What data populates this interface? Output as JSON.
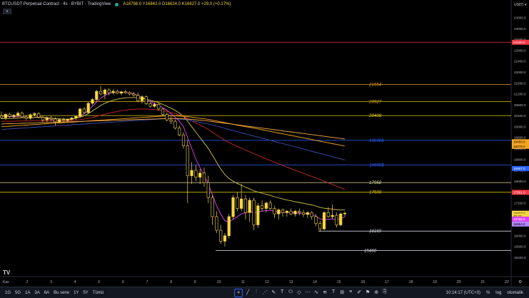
{
  "header": {
    "symbol": "BTCUSDT Perpetual Contract · 4s · BYBIT · TradingView",
    "ohlc": "A16798.0  Y16842.0  D16624.0  K16827.0  +29.0 (+0.17%)",
    "collapse": "∧"
  },
  "price_axis": {
    "currency": "USDT ▾",
    "ticks": [
      "24000.0",
      "23600.0",
      "23200.0",
      "22800.0",
      "22400.0",
      "22000.0",
      "21600.0",
      "21200.0",
      "20800.0",
      "20400.0",
      "20000.0",
      "19600.0",
      "19200.0",
      "18800.0",
      "18400.0",
      "18000.0",
      "17600.0",
      "17200.0",
      "16800.0",
      "16400.0",
      "16000.0",
      "15600.0",
      "15200.0"
    ],
    "min": 14500,
    "max": 24650,
    "badges": [
      {
        "price": 23100,
        "label": "23100.0",
        "bg": "#f23645",
        "fg": "#ffffff"
      },
      {
        "price": 19450,
        "label": "19450.0",
        "bg": "#f5a623",
        "fg": "#000000"
      },
      {
        "price": 19280,
        "label": "19278.0",
        "bg": "#f5a623",
        "fg": "#000000"
      },
      {
        "price": 18467,
        "label": "18467.0",
        "bg": "#2962ff",
        "fg": "#ffffff"
      },
      {
        "price": 17591,
        "label": "17591.0",
        "bg": "#f23645",
        "fg": "#ffffff"
      },
      {
        "price": 16827,
        "label": "16827.0",
        "bg": "#f5d742",
        "fg": "#000000"
      },
      {
        "price": 16720,
        "label": "45:42",
        "bg": "#f5d742",
        "fg": "#000000"
      },
      {
        "price": 16610,
        "label": "16795.5",
        "bg": "#e040fb",
        "fg": "#ffffff"
      },
      {
        "price": 16430,
        "label": "16654.0",
        "bg": "#b388ff",
        "fg": "#000000"
      }
    ]
  },
  "time_axis": {
    "labels": [
      "Kas",
      "2",
      "3",
      "4",
      "5",
      "6",
      "7",
      "8",
      "9",
      "10",
      "11",
      "12",
      "13",
      "14",
      "15",
      "16",
      "17",
      "18",
      "19",
      "20",
      "21",
      "22"
    ],
    "gear": "⚙"
  },
  "levels": [
    {
      "price": 23100,
      "label": "",
      "color": "#f23645",
      "x0": 0
    },
    {
      "price": 21554,
      "label": "21554",
      "color": "#e5a01d",
      "x0": 0
    },
    {
      "price": 20927,
      "label": "20927",
      "color": "#d4b106",
      "x0": 0
    },
    {
      "price": 20408,
      "label": "20408",
      "color": "#e8d200",
      "x0": 0
    },
    {
      "price": 19500,
      "label": "19500$",
      "color": "#2962ff",
      "x0": 0
    },
    {
      "price": 18600,
      "label": "18600$",
      "color": "#2962ff",
      "x0": 0
    },
    {
      "price": 17950,
      "label": "17950",
      "color": "#e8e0a0",
      "x0": 0
    },
    {
      "price": 17600,
      "label": "17600",
      "color": "#e8d200",
      "x0": 0
    },
    {
      "price": 16169,
      "label": "16169",
      "color": "#d1d4dc",
      "x0": 446
    },
    {
      "price": 15460,
      "label": "15460",
      "color": "#d1d4dc",
      "x0": 302
    }
  ],
  "chart_data": {
    "type": "candlestick",
    "y_range": [
      14500,
      24650
    ],
    "candle_color": "#f5d742",
    "candles": [
      [
        20400,
        20560,
        20280,
        20330
      ],
      [
        20330,
        20480,
        20250,
        20460
      ],
      [
        20460,
        20520,
        20330,
        20380
      ],
      [
        20380,
        20470,
        20300,
        20420
      ],
      [
        20420,
        20560,
        20360,
        20500
      ],
      [
        20500,
        20560,
        20320,
        20360
      ],
      [
        20360,
        20420,
        20240,
        20310
      ],
      [
        20310,
        20480,
        20250,
        20440
      ],
      [
        20440,
        20530,
        20380,
        20480
      ],
      [
        20480,
        20540,
        20300,
        20350
      ],
      [
        20350,
        20400,
        20180,
        20250
      ],
      [
        20250,
        20380,
        20150,
        20320
      ],
      [
        20320,
        20400,
        20210,
        20280
      ],
      [
        20280,
        20350,
        20050,
        20180
      ],
      [
        20180,
        20300,
        20120,
        20260
      ],
      [
        20260,
        20330,
        20180,
        20230
      ],
      [
        20230,
        20300,
        20150,
        20270
      ],
      [
        20270,
        20360,
        20220,
        20320
      ],
      [
        20320,
        20420,
        20260,
        20380
      ],
      [
        20380,
        20700,
        20330,
        20650
      ],
      [
        20650,
        20720,
        20450,
        20520
      ],
      [
        20520,
        20900,
        20480,
        20860
      ],
      [
        20860,
        21050,
        20800,
        21000
      ],
      [
        21000,
        21350,
        20940,
        21300
      ],
      [
        21300,
        21500,
        21150,
        21200
      ],
      [
        21200,
        21400,
        21000,
        21350
      ],
      [
        21350,
        21420,
        21150,
        21250
      ],
      [
        21250,
        21380,
        21180,
        21300
      ],
      [
        21300,
        21360,
        21200,
        21230
      ],
      [
        21230,
        21320,
        21150,
        21280
      ],
      [
        21280,
        21350,
        21200,
        21250
      ],
      [
        21250,
        21300,
        21150,
        21200
      ],
      [
        21200,
        21280,
        21100,
        21150
      ],
      [
        21150,
        21250,
        20900,
        20950
      ],
      [
        20950,
        21150,
        20850,
        21100
      ],
      [
        21100,
        21150,
        20800,
        20850
      ],
      [
        20850,
        20900,
        20700,
        20750
      ],
      [
        20750,
        20900,
        20700,
        20820
      ],
      [
        20820,
        20880,
        20600,
        20650
      ],
      [
        20650,
        20700,
        20400,
        20450
      ],
      [
        20450,
        20520,
        20200,
        20250
      ],
      [
        20250,
        20380,
        20100,
        20200
      ],
      [
        20200,
        20260,
        19900,
        19950
      ],
      [
        19950,
        20050,
        19650,
        19700
      ],
      [
        19700,
        19800,
        19200,
        19300
      ],
      [
        19300,
        19500,
        17200,
        18200
      ],
      [
        18200,
        18700,
        17900,
        18400
      ],
      [
        18400,
        18600,
        18000,
        18150
      ],
      [
        18150,
        18450,
        17900,
        18300
      ],
      [
        18300,
        18500,
        17800,
        17950
      ],
      [
        17950,
        18200,
        17200,
        17400
      ],
      [
        17400,
        17500,
        16400,
        16700
      ],
      [
        16700,
        16900,
        16100,
        16200
      ],
      [
        16200,
        16400,
        15700,
        15800
      ],
      [
        15800,
        16100,
        15600,
        16000
      ],
      [
        16000,
        16800,
        15900,
        16700
      ],
      [
        16700,
        17500,
        16600,
        17400
      ],
      [
        17400,
        17600,
        16900,
        17000
      ],
      [
        17000,
        17900,
        16900,
        17350
      ],
      [
        17350,
        17500,
        16600,
        16850
      ],
      [
        16850,
        17400,
        16500,
        17300
      ],
      [
        17300,
        17400,
        16200,
        16400
      ],
      [
        16400,
        17200,
        16300,
        17100
      ],
      [
        17100,
        17300,
        16900,
        17000
      ],
      [
        17000,
        17250,
        16850,
        17200
      ],
      [
        17200,
        17300,
        16950,
        17000
      ],
      [
        17000,
        17100,
        16650,
        16800
      ],
      [
        16800,
        17000,
        16600,
        16950
      ],
      [
        16950,
        17000,
        16700,
        16850
      ],
      [
        16850,
        16950,
        16700,
        16900
      ],
      [
        16900,
        17000,
        16750,
        16800
      ],
      [
        16800,
        16950,
        16700,
        16900
      ],
      [
        16900,
        17000,
        16750,
        16850
      ],
      [
        16850,
        16950,
        16680,
        16780
      ],
      [
        16780,
        16900,
        16650,
        16850
      ],
      [
        16850,
        16900,
        16600,
        16700
      ],
      [
        16700,
        16800,
        16350,
        16450
      ],
      [
        16450,
        16550,
        16150,
        16250
      ],
      [
        16250,
        16900,
        16200,
        16850
      ],
      [
        16850,
        17050,
        16650,
        16700
      ],
      [
        16700,
        17150,
        16600,
        16750
      ],
      [
        16750,
        16850,
        16300,
        16400
      ],
      [
        16400,
        16850,
        16350,
        16800
      ],
      [
        16800,
        16890,
        16700,
        16827
      ]
    ],
    "ma_lines": [
      {
        "color": "#e040fb",
        "values": [
          20400,
          20380,
          20370,
          20360,
          20380,
          20390,
          20350,
          20320,
          20340,
          20380,
          20350,
          20300,
          20270,
          20230,
          20220,
          20230,
          20240,
          20270,
          20320,
          20400,
          20480,
          20600,
          20750,
          20900,
          21050,
          21150,
          21220,
          21260,
          21270,
          21270,
          21260,
          21240,
          21210,
          21150,
          21080,
          21000,
          20920,
          20850,
          20780,
          20700,
          20600,
          20480,
          20350,
          20200,
          20000,
          19600,
          19200,
          18800,
          18500,
          18200,
          17900,
          17500,
          17100,
          16800,
          16550,
          16500,
          16600,
          16700,
          16800,
          16850,
          16900,
          16850,
          16870,
          16900,
          16920,
          16930,
          16900,
          16880,
          16860,
          16850,
          16840,
          16830,
          16830,
          16820,
          16810,
          16790,
          16720,
          16620,
          16600,
          16600,
          16620,
          16580,
          16620,
          16700
        ]
      },
      {
        "color": "#d4c24a",
        "values": [
          20300,
          20300,
          20300,
          20310,
          20320,
          20330,
          20330,
          20330,
          20340,
          20350,
          20340,
          20330,
          20320,
          20300,
          20290,
          20280,
          20280,
          20290,
          20310,
          20350,
          20400,
          20480,
          20580,
          20680,
          20780,
          20860,
          20920,
          20970,
          21010,
          21040,
          21060,
          21070,
          21070,
          21060,
          21040,
          21010,
          20970,
          20930,
          20880,
          20820,
          20750,
          20680,
          20600,
          20500,
          20380,
          20200,
          20000,
          19800,
          19600,
          19400,
          19200,
          18950,
          18700,
          18450,
          18250,
          18100,
          18000,
          17920,
          17850,
          17780,
          17720,
          17650,
          17600,
          17560,
          17520,
          17480,
          17430,
          17390,
          17350,
          17310,
          17280,
          17250,
          17220,
          17190,
          17160,
          17130,
          17090,
          17040,
          17010,
          16990,
          16980,
          16960,
          16950,
          16950
        ]
      },
      {
        "color": "#c62828",
        "values": [
          20200,
          20200,
          20200,
          20200,
          20210,
          20210,
          20210,
          20210,
          20220,
          20220,
          20220,
          20220,
          20220,
          20220,
          20220,
          20220,
          20220,
          20230,
          20240,
          20260,
          20280,
          20310,
          20340,
          20380,
          20420,
          20460,
          20500,
          20530,
          20560,
          20590,
          20610,
          20630,
          20640,
          20650,
          20650,
          20650,
          20640,
          20630,
          20610,
          20590,
          20560,
          20520,
          20480,
          20440,
          20380,
          20300,
          20220,
          20140,
          20060,
          19980,
          19900,
          19800,
          19700,
          19600,
          19500,
          19420,
          19350,
          19280,
          19210,
          19140,
          19080,
          19010,
          18950,
          18880,
          18820,
          18760,
          18700,
          18640,
          18580,
          18520,
          18460,
          18400,
          18350,
          18290,
          18230,
          18180,
          18120,
          18060,
          18000,
          17940,
          17880,
          17820,
          17760,
          17700
        ]
      },
      {
        "color": "#3f51b5",
        "values": [
          19900,
          19910,
          19920,
          19930,
          19940,
          19950,
          19960,
          19970,
          19980,
          19990,
          20000,
          20010,
          20020,
          20030,
          20040,
          20050,
          20060,
          20070,
          20080,
          20090,
          20100,
          20110,
          20120,
          20130,
          20140,
          20150,
          20160,
          20170,
          20180,
          20190,
          20200,
          20210,
          20220,
          20230,
          20240,
          20250,
          20260,
          20270,
          20280,
          20290,
          20300,
          20300,
          20290,
          20280,
          20270,
          20250,
          20220,
          20190,
          20160,
          20130,
          20100,
          20060,
          20020,
          19980,
          19940,
          19900,
          19860,
          19820,
          19780,
          19740,
          19700,
          19660,
          19620,
          19580,
          19540,
          19500,
          19460,
          19420,
          19380,
          19340,
          19300,
          19260,
          19220,
          19180,
          19140,
          19100,
          19060,
          19020,
          18980,
          18940,
          18900,
          18860,
          18820,
          18780
        ]
      },
      {
        "color": "#f5a623",
        "values": [
          20000,
          20010,
          20020,
          20030,
          20040,
          20050,
          20060,
          20070,
          20080,
          20090,
          20100,
          20110,
          20120,
          20130,
          20140,
          20150,
          20160,
          20170,
          20180,
          20190,
          20200,
          20210,
          20220,
          20230,
          20240,
          20250,
          20260,
          20270,
          20280,
          20290,
          20300,
          20310,
          20320,
          20330,
          20340,
          20350,
          20360,
          20370,
          20380,
          20390,
          20400,
          20400,
          20400,
          20390,
          20380,
          20370,
          20350,
          20330,
          20310,
          20290,
          20270,
          20240,
          20210,
          20180,
          20150,
          20120,
          20090,
          20060,
          20030,
          20000,
          19980,
          19950,
          19920,
          19890,
          19860,
          19830,
          19800,
          19770,
          19740,
          19710,
          19680,
          19650,
          19620,
          19590,
          19560,
          19530,
          19500,
          19470,
          19440,
          19410,
          19380,
          19350,
          19320,
          19290
        ]
      },
      {
        "color": "#f8a94b",
        "values": [
          20100,
          20105,
          20110,
          20115,
          20120,
          20125,
          20130,
          20135,
          20140,
          20145,
          20150,
          20155,
          20160,
          20165,
          20170,
          20175,
          20180,
          20185,
          20190,
          20195,
          20200,
          20205,
          20210,
          20215,
          20220,
          20225,
          20230,
          20235,
          20240,
          20245,
          20250,
          20255,
          20260,
          20265,
          20270,
          20275,
          20280,
          20285,
          20290,
          20295,
          20300,
          20300,
          20300,
          20295,
          20290,
          20280,
          20270,
          20255,
          20240,
          20225,
          20210,
          20190,
          20170,
          20150,
          20130,
          20110,
          20090,
          20070,
          20050,
          20030,
          20010,
          19990,
          19970,
          19950,
          19930,
          19910,
          19890,
          19870,
          19850,
          19830,
          19810,
          19790,
          19770,
          19750,
          19730,
          19710,
          19690,
          19670,
          19650,
          19630,
          19610,
          19590,
          19570,
          19550
        ]
      }
    ]
  },
  "bottom_bar": {
    "timeframes": [
      "1G",
      "5G",
      "1A",
      "3A",
      "6A",
      "Bu sene",
      "1Y",
      "5Y",
      "Tümü"
    ],
    "tools": [
      "⌖",
      "╱",
      "⫶",
      "⋰",
      "✎",
      "T",
      "⬭",
      "◇",
      "⋯",
      "∿",
      "≋",
      "T",
      "⊞",
      "≡",
      "✐",
      "⚑",
      "⊕",
      "⎘"
    ],
    "time": "10:14:17 (UTC+3)",
    "percent": "%",
    "log": "log",
    "auto": "otomatik"
  }
}
